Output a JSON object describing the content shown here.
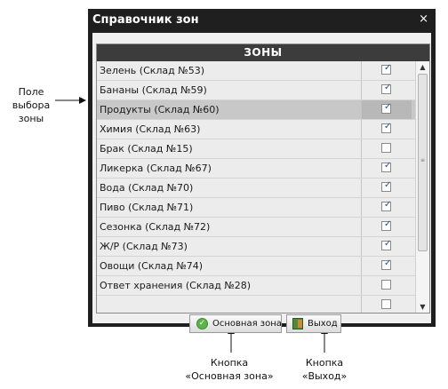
{
  "window": {
    "title": "Справочник зон",
    "close_glyph": "×"
  },
  "grid": {
    "header": "ЗОНЫ",
    "rows": [
      {
        "name": "Зелень (Склад №53)",
        "checked": true,
        "selected": false
      },
      {
        "name": "Бананы (Склад №59)",
        "checked": true,
        "selected": false
      },
      {
        "name": "Продукты (Склад №60)",
        "checked": true,
        "selected": true
      },
      {
        "name": "Химия (Склад №63)",
        "checked": true,
        "selected": false
      },
      {
        "name": "Брак (Склад №15)",
        "checked": false,
        "selected": false
      },
      {
        "name": "Ликерка (Склад №67)",
        "checked": true,
        "selected": false
      },
      {
        "name": "Вода (Склад №70)",
        "checked": true,
        "selected": false
      },
      {
        "name": "Пиво (Склад №71)",
        "checked": true,
        "selected": false
      },
      {
        "name": "Сезонка (Склад №72)",
        "checked": true,
        "selected": false
      },
      {
        "name": "Ж/Р (Склад №73)",
        "checked": true,
        "selected": false
      },
      {
        "name": "Овощи (Склад №74)",
        "checked": true,
        "selected": false
      },
      {
        "name": "Ответ хранения (Склад №28)",
        "checked": false,
        "selected": false
      },
      {
        "name": "",
        "checked": false,
        "selected": false
      }
    ],
    "check_glyph": "✓"
  },
  "buttons": {
    "main_zone": {
      "label": "Основная зона",
      "icon": "ok-icon"
    },
    "exit": {
      "label": "Выход",
      "icon": "exit-door-icon"
    }
  },
  "annotations": {
    "zone_field": "Поле выбора зоны",
    "main_zone_button": "Кнопка «Основная зона»",
    "exit_button": "Кнопка «Выход»"
  },
  "colors": {
    "window_frame": "#1f1f1f",
    "header_bg": "#3c3c3c",
    "row_bg": "#ececec",
    "selected_row_bg": "#c8c8c8",
    "check_color": "#2a4a9a"
  }
}
